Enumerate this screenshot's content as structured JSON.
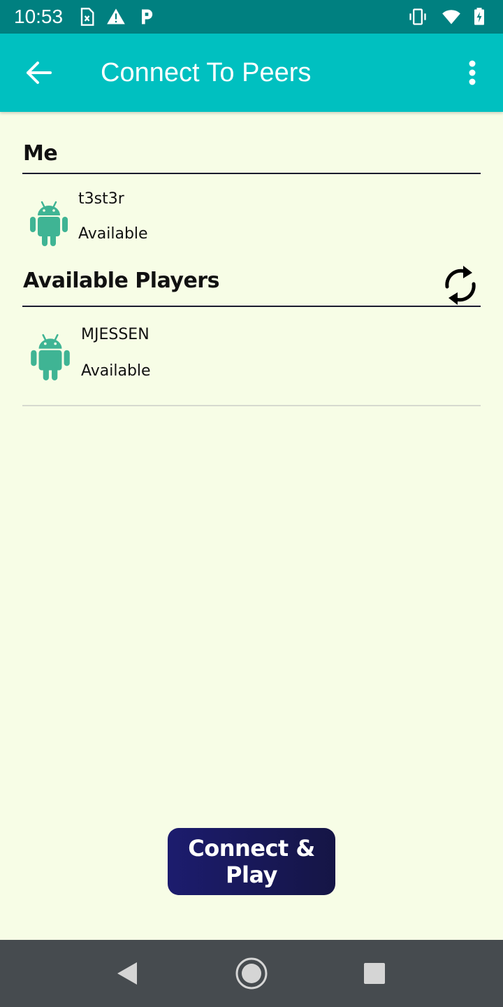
{
  "status_bar": {
    "time": "10:53",
    "left_icons": [
      "sim-card-icon",
      "warning-icon",
      "parking-icon"
    ],
    "right_icons": [
      "vibrate-icon",
      "wifi-icon",
      "battery-charging-icon"
    ]
  },
  "app_bar": {
    "title": "Connect To Peers",
    "back_icon": "arrow-back-icon",
    "menu_icon": "more-vertical-icon"
  },
  "me_section": {
    "title": "Me",
    "device": {
      "name": "t3st3r",
      "status": "Available",
      "icon": "android-icon"
    }
  },
  "players_section": {
    "title": "Available Players",
    "refresh_icon": "refresh-icon",
    "players": [
      {
        "name": "MJESSEN",
        "status": "Available",
        "icon": "android-icon"
      }
    ]
  },
  "connect_button": {
    "label": "Connect & Play"
  },
  "nav_bar": {
    "icons": [
      "nav-back-icon",
      "nav-home-icon",
      "nav-recents-icon"
    ]
  },
  "colors": {
    "status_bar": "#008080",
    "app_bar": "#00c0c0",
    "background": "#f7fde6",
    "android_green": "#3fb494",
    "button": "#1c1c6e",
    "nav_bar": "#464b4f"
  }
}
